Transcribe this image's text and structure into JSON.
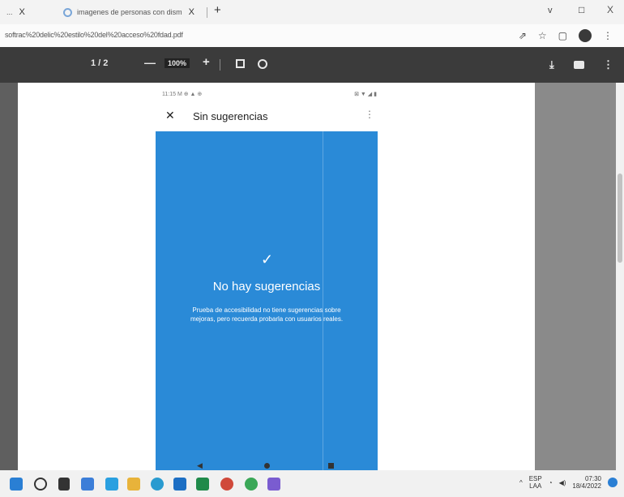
{
  "browser": {
    "tabs": [
      {
        "label": "...",
        "close": "X"
      },
      {
        "label": "imagenes de personas con dism",
        "close": "X"
      }
    ],
    "new_tab": "+",
    "tab_search": "v",
    "minimize": "□",
    "close_window": "X",
    "url": "softrac%20delic%20estilo%20del%20acceso%20fdad.pdf"
  },
  "pdf_toolbar": {
    "page_indicator": "1 / 2",
    "zoom_out": "—",
    "zoom_level": "100%",
    "zoom_in": "+",
    "more": "⋮"
  },
  "phone": {
    "status_left": "11:15 M ⊕ ▲ ⊕",
    "status_right": "⊠ ▼ ◢ ▮",
    "close": "✕",
    "title": "Sin sugerencias",
    "menu": "⋮",
    "check": "✓",
    "heading": "No hay sugerencias",
    "body": "Prueba de accesibilidad no tiene sugerencias sobre mejoras, pero recuerda probarla con usuarios reales."
  },
  "taskbar": {
    "tray_arrow": "^",
    "language_top": "ESP",
    "language_bottom": "LAA",
    "time": "07:30",
    "date": "18/4/2022"
  },
  "colors": {
    "accent_blue": "#2a8ad7",
    "pdf_toolbar": "#3b3b3b"
  }
}
